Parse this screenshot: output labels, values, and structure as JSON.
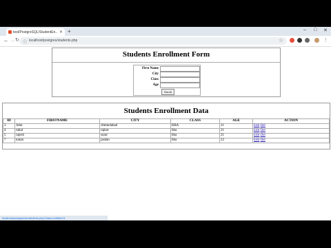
{
  "browser": {
    "tab_title": "test/PostgreSQL/StudentEn...",
    "url": "localhost/postgres/students.php",
    "status_url": "localhost/postgres/studentinfo.php?class=edit&id=5"
  },
  "form": {
    "title": "Students Enrollment Form",
    "labels": [
      "First Name",
      "City",
      "Class",
      "Age"
    ],
    "submit_label": "Enroll"
  },
  "data": {
    "title": "Students Enrollment Data",
    "columns": [
      "ID",
      "FIRSTNAME",
      "CITY",
      "CLASS",
      "AGE",
      "ACTION"
    ],
    "rows": [
      {
        "id": "3",
        "firstname": "John",
        "city": "Ahmedabad",
        "class": "BBA",
        "age": "21",
        "edit": "Edit",
        "del": "Del"
      },
      {
        "id": "4",
        "firstname": "rahul",
        "city": "rajkot",
        "class": "bba",
        "age": "21",
        "edit": "Edit",
        "del": "Del"
      },
      {
        "id": "5",
        "firstname": "rajesh",
        "city": "surat",
        "class": "bba",
        "age": "21",
        "edit": "Edit",
        "del": "Del"
      },
      {
        "id": "7",
        "firstname": "nutan",
        "city": "jasdan",
        "class": "bba",
        "age": "22",
        "edit": "Edit",
        "del": "Del"
      }
    ]
  }
}
